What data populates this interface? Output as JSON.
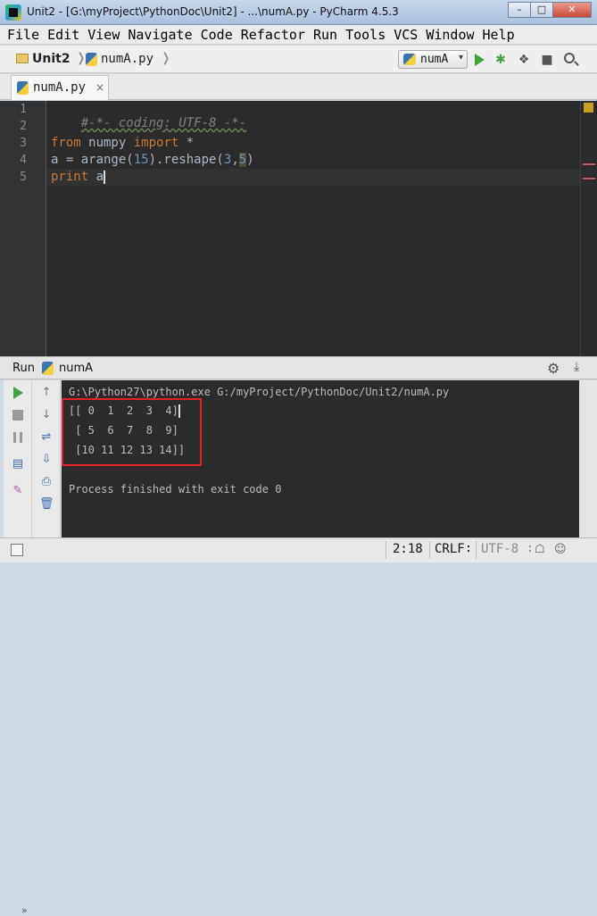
{
  "window": {
    "title": "Unit2 - [G:\\myProject\\PythonDoc\\Unit2] - ...\\numA.py - PyCharm 4.5.3",
    "minimize": "–",
    "maximize": "□",
    "close": "✕"
  },
  "menu": [
    "File",
    "Edit",
    "View",
    "Navigate",
    "Code",
    "Refactor",
    "Run",
    "Tools",
    "VCS",
    "Window",
    "Help"
  ],
  "navbar": {
    "breadcrumb_project": "Unit2",
    "breadcrumb_file": "numA.py",
    "breadcrumb_sep": "❭",
    "run_config": "numA",
    "run_config_arrow": "▾"
  },
  "editor_tab": {
    "label": "numA.py",
    "close": "×"
  },
  "editor": {
    "line_numbers": [
      "1",
      "2",
      "3",
      "4",
      "5"
    ],
    "line1_comment": "#-*- coding: UTF-8 -*-",
    "line3_kw1": "from",
    "line3_mod": " numpy ",
    "line3_kw2": "import",
    "line3_rest": " *",
    "line4_pre": "a = arange(",
    "line4_num1": "15",
    "line4_mid": ").reshape(",
    "line4_num2": "3",
    "line4_comma": ",",
    "line4_num3": "5",
    "line4_close": ")",
    "line5_kw": "print",
    "line5_rest": " a"
  },
  "run_panel": {
    "label": "Run",
    "config_name": "numA",
    "gear": "⚙",
    "hide": "⤓",
    "more": "»"
  },
  "console": {
    "command": "G:\\Python27\\python.exe G:/myProject/PythonDoc/Unit2/numA.py",
    "output_lines": [
      "[[ 0  1  2  3  4]",
      " [ 5  6  7  8  9]",
      " [10 11 12 13 14]]"
    ],
    "exit_message": "Process finished with exit code 0"
  },
  "statusbar": {
    "position": "2:18",
    "line_separator": "CRLF∶",
    "encoding": "UTF-8 ∶",
    "lock": "☖",
    "inspector": "☺"
  }
}
